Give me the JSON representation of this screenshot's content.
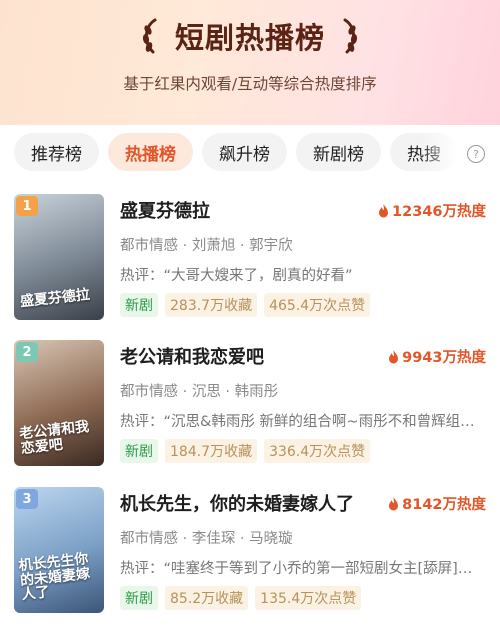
{
  "header": {
    "title": "短剧热播榜",
    "subtitle": "基于红果内观看/互动等综合热度排序"
  },
  "tabs": [
    {
      "label": "推荐榜",
      "active": false
    },
    {
      "label": "热播榜",
      "active": true
    },
    {
      "label": "飙升榜",
      "active": false
    },
    {
      "label": "新剧榜",
      "active": false
    },
    {
      "label": "热搜",
      "active": false
    }
  ],
  "help_icon": {
    "icon": "question-circle-icon",
    "glyph": "?"
  },
  "items": [
    {
      "rank": "1",
      "rank_color": "#f4a24a",
      "title": "盛夏芬德拉",
      "heat": "12346万热度",
      "tags": "都市情感 · 刘萧旭 · 郭宇欣",
      "review": "热评：“大哥大嫂来了，剧真的好看”",
      "badge_new": "新剧",
      "collect": "283.7万收藏",
      "likes": "465.4万次点赞",
      "poster_text": "盛夏芬德拉",
      "poster_colors": [
        "#c9d3dc",
        "#7b8793",
        "#3b4048"
      ]
    },
    {
      "rank": "2",
      "rank_color": "#7dc8b4",
      "title": "老公请和我恋爱吧",
      "heat": "9943万热度",
      "tags": "都市情感 · 沉思 · 韩雨彤",
      "review": "热评：“沉思&韩雨彤 新鲜的组合啊~雨彤不和曾辉组…",
      "badge_new": "新剧",
      "collect": "184.7万收藏",
      "likes": "336.4万次点赞",
      "poster_text": "老公请和我恋爱吧",
      "poster_colors": [
        "#d8c7b4",
        "#8e6a54",
        "#3a2a22"
      ]
    },
    {
      "rank": "3",
      "rank_color": "#7fa7e0",
      "title": "机长先生，你的未婚妻嫁人了",
      "heat": "8142万热度",
      "tags": "都市情感 · 李佳琛 · 马晓璇",
      "review": "热评：“哇塞终于等到了小乔的第一部短剧女主[舔屏]…",
      "badge_new": "新剧",
      "collect": "85.2万收藏",
      "likes": "135.4万次点赞",
      "poster_text": "机长先生你的未婚妻嫁人了",
      "poster_colors": [
        "#bcd6ef",
        "#7b9fc6",
        "#3c5577"
      ]
    }
  ]
}
